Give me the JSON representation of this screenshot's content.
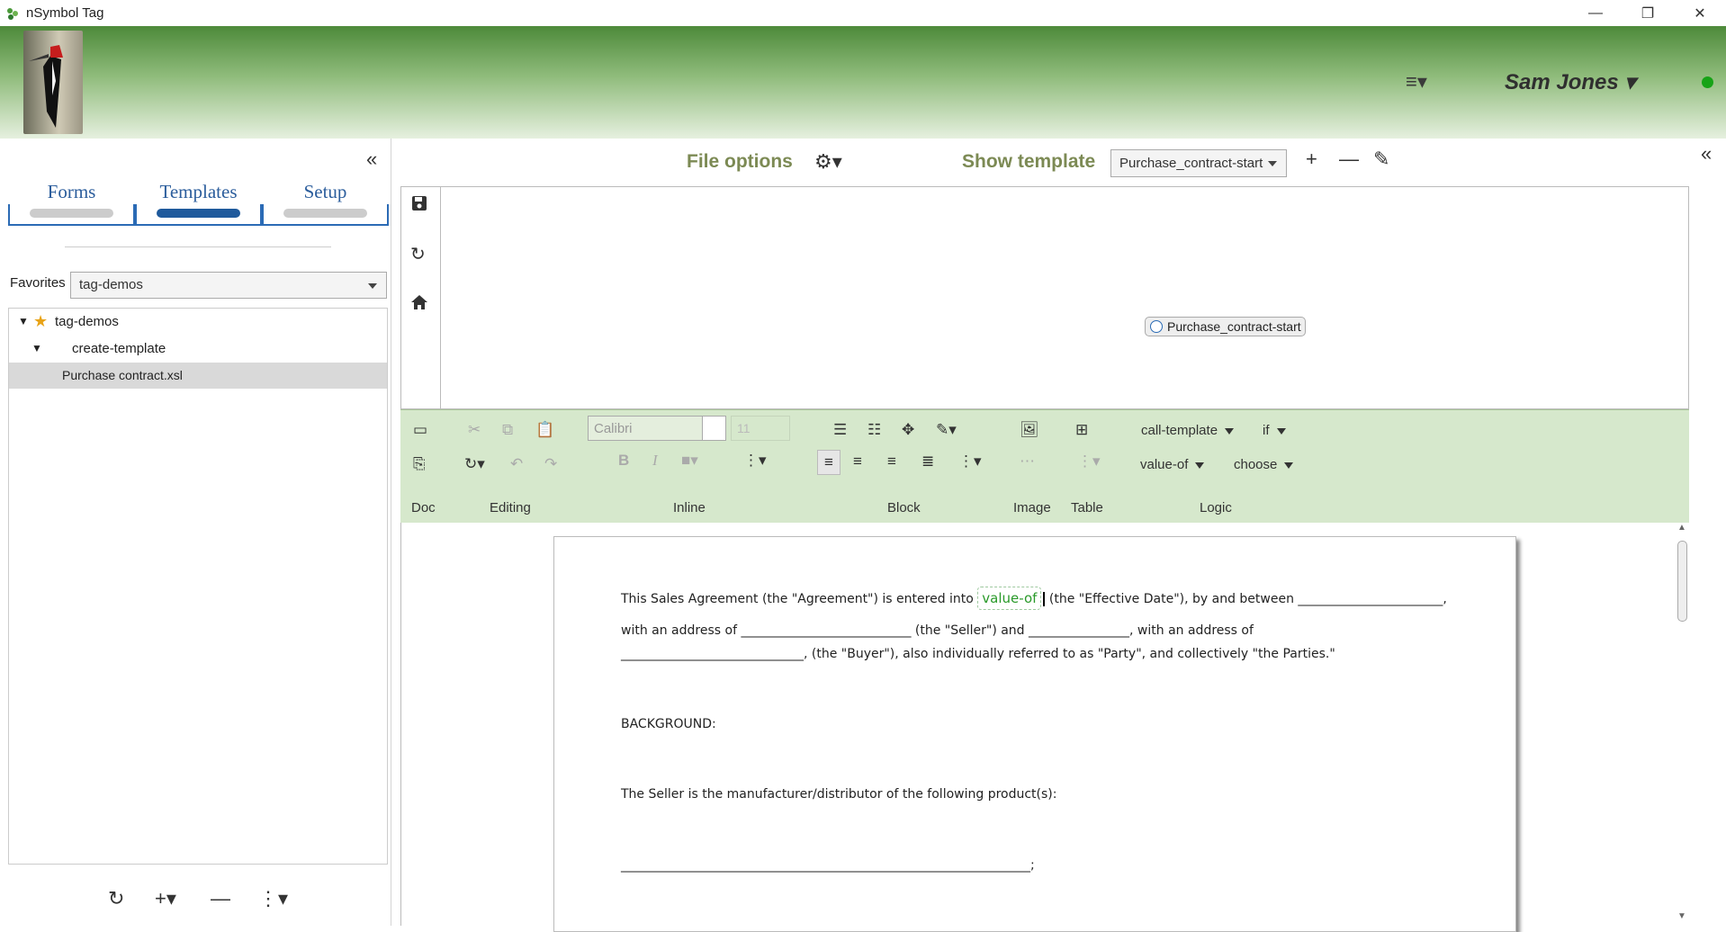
{
  "window": {
    "title": "nSymbol Tag",
    "min": "—",
    "restore": "❐",
    "close": "✕"
  },
  "header": {
    "menu_icon": "≡▾",
    "user_name": "Sam Jones ▾",
    "status_color": "#17a317"
  },
  "left": {
    "collapse": "«",
    "tabs": [
      {
        "label": "Forms"
      },
      {
        "label": "Templates"
      },
      {
        "label": "Setup"
      }
    ],
    "favorites_label": "Favorites",
    "favorites_value": "tag-demos",
    "tree": [
      {
        "label": "tag-demos",
        "expanded": true
      },
      {
        "label": "create-template",
        "expanded": true
      },
      {
        "label": "Purchase contract.xsl",
        "selected": true
      }
    ],
    "bottom": {
      "refresh": "↻",
      "add": "+▾",
      "remove": "—",
      "more": "⋮▾"
    }
  },
  "main": {
    "file_options_label": "File options",
    "gear": "⚙▾",
    "show_template_label": "Show template",
    "template_value": "Purchase_contract-start",
    "plus": "+",
    "minus": "—",
    "pencil": "✎",
    "side_tools": {
      "save": "💾",
      "refresh": "↻",
      "home": "⌂"
    },
    "node_label": "Purchase_contract-start",
    "right_collapse": "«"
  },
  "ribbon": {
    "font": "Calibri",
    "size": "11",
    "groups": {
      "doc": "Doc",
      "editing": "Editing",
      "inline": "Inline",
      "block": "Block",
      "image": "Image",
      "table": "Table",
      "logic": "Logic"
    },
    "logic_items": {
      "call_template": "call-template",
      "if": "if",
      "value_of": "value-of",
      "choose": "choose"
    },
    "b": "B",
    "i": "I"
  },
  "document": {
    "l1a": "This Sales Agreement (the \"Agreement\") is entered into",
    "chip": "value-of",
    "l1b": "(the \"Effective Date\"), by and between _______________________,",
    "l2": "with an address of ___________________________ (the \"Seller\") and ________________, with an address of",
    "l3": "_____________________________, (the \"Buyer\"), also individually referred to as \"Party\", and collectively \"the Parties.\"",
    "l4": "BACKGROUND:",
    "l5": "The Seller is the manufacturer/distributor of the following product(s):",
    "l6": "_________________________________________________________________;"
  }
}
